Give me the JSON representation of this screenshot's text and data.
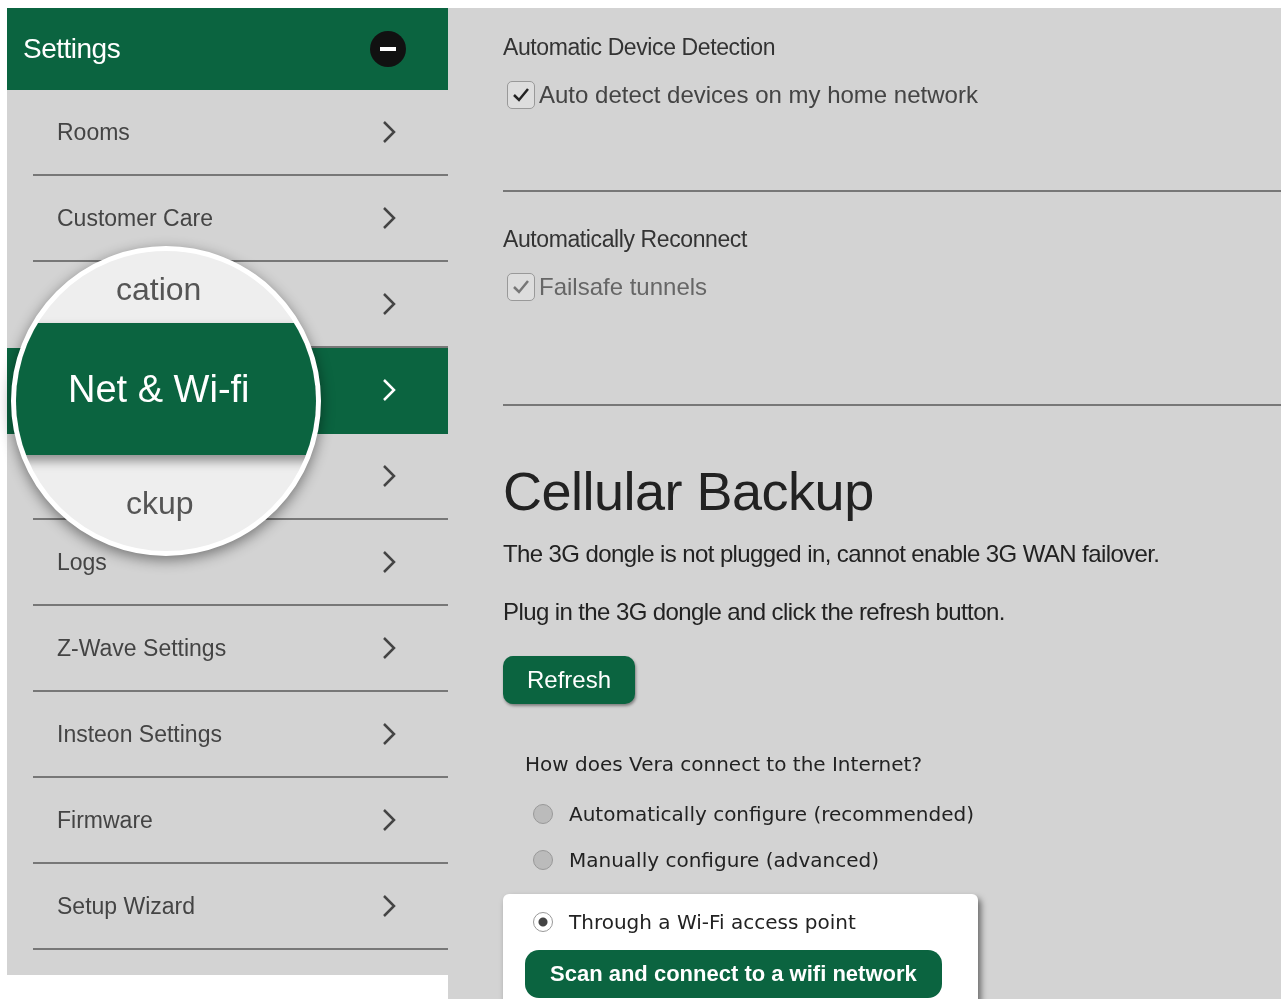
{
  "sidebar": {
    "title": "Settings",
    "items": [
      {
        "label": "Rooms",
        "selected": false
      },
      {
        "label": "Customer Care",
        "selected": false
      },
      {
        "selected": false
      },
      {
        "selected": true
      },
      {
        "selected": false
      },
      {
        "label": "Logs",
        "selected": false
      },
      {
        "label": "Z-Wave Settings",
        "selected": false
      },
      {
        "label": "Insteon Settings",
        "selected": false
      },
      {
        "label": "Firmware",
        "selected": false
      },
      {
        "label": "Setup Wizard",
        "selected": false
      }
    ]
  },
  "magnifier": {
    "top_text": "cation",
    "label": "Net & Wi-fi",
    "bottom_text": "ckup"
  },
  "sections": [
    {
      "heading": "Automatic Device Detection",
      "checkbox": {
        "label": "Auto detect devices on my home network",
        "checked": true,
        "disabled": false
      }
    },
    {
      "heading": "Automatically Reconnect",
      "checkbox": {
        "label": "Failsafe tunnels",
        "checked": true,
        "disabled": true
      }
    }
  ],
  "cellular": {
    "title": "Cellular Backup",
    "messages": [
      "The 3G dongle is not plugged in, cannot enable 3G WAN failover.",
      "Plug in the 3G dongle and click the refresh button."
    ],
    "button": "Refresh"
  },
  "connection": {
    "question": "How does Vera connect to the Internet?",
    "options": [
      {
        "label": "Automatically configure (recommended)",
        "selected": false
      },
      {
        "label": "Manually configure (advanced)",
        "selected": false
      },
      {
        "label": "Through a Wi-Fi access point",
        "selected": true
      }
    ],
    "scan_button": "Scan and connect to a wifi network"
  }
}
